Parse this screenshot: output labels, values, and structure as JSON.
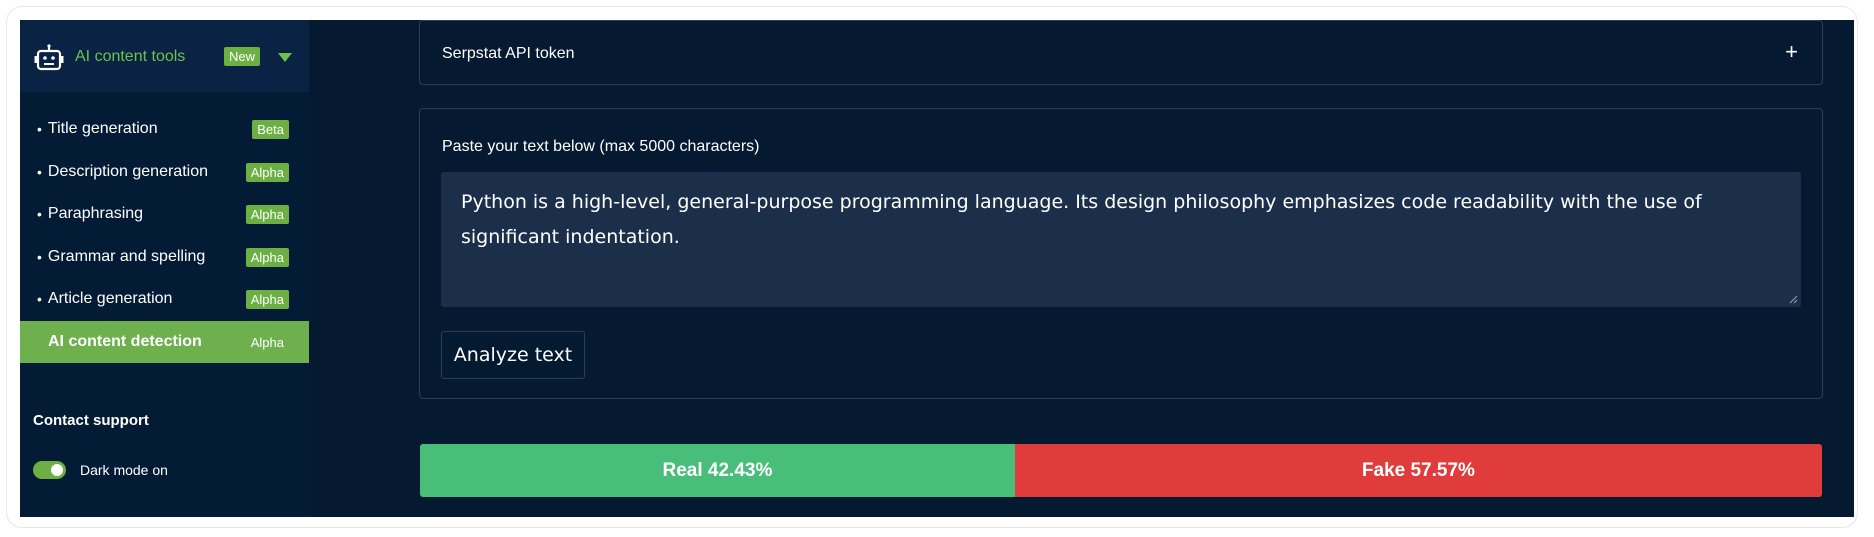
{
  "colors": {
    "accent": "#6cb043",
    "real": "#49bd7a",
    "fake": "#e03c3c",
    "background": "#051a31"
  },
  "sidebar": {
    "header": {
      "title": "AI content tools",
      "badge": "New",
      "icon": "robot-icon"
    },
    "items": [
      {
        "label": "Title generation",
        "badge": "Beta"
      },
      {
        "label": "Description generation",
        "badge": "Alpha"
      },
      {
        "label": "Paraphrasing",
        "badge": "Alpha"
      },
      {
        "label": "Grammar and spelling",
        "badge": "Alpha"
      },
      {
        "label": "Article generation",
        "badge": "Alpha"
      },
      {
        "label": "AI content detection",
        "badge": "Alpha",
        "active": true
      }
    ],
    "contact": "Contact support",
    "dark_mode": {
      "label": "Dark mode on",
      "on": true
    }
  },
  "token": {
    "label": "Serpstat API token",
    "expand_icon": "+"
  },
  "text_input": {
    "label": "Paste your text below (max 5000 characters)",
    "value": "Python is a high-level, general-purpose programming language. Its design philosophy emphasizes code readability with the use of significant indentation."
  },
  "analyze_button": "Analyze text",
  "result": {
    "real": {
      "label": "Real 42.43%",
      "percent": 42.43
    },
    "fake": {
      "label": "Fake 57.57%",
      "percent": 57.57
    }
  }
}
